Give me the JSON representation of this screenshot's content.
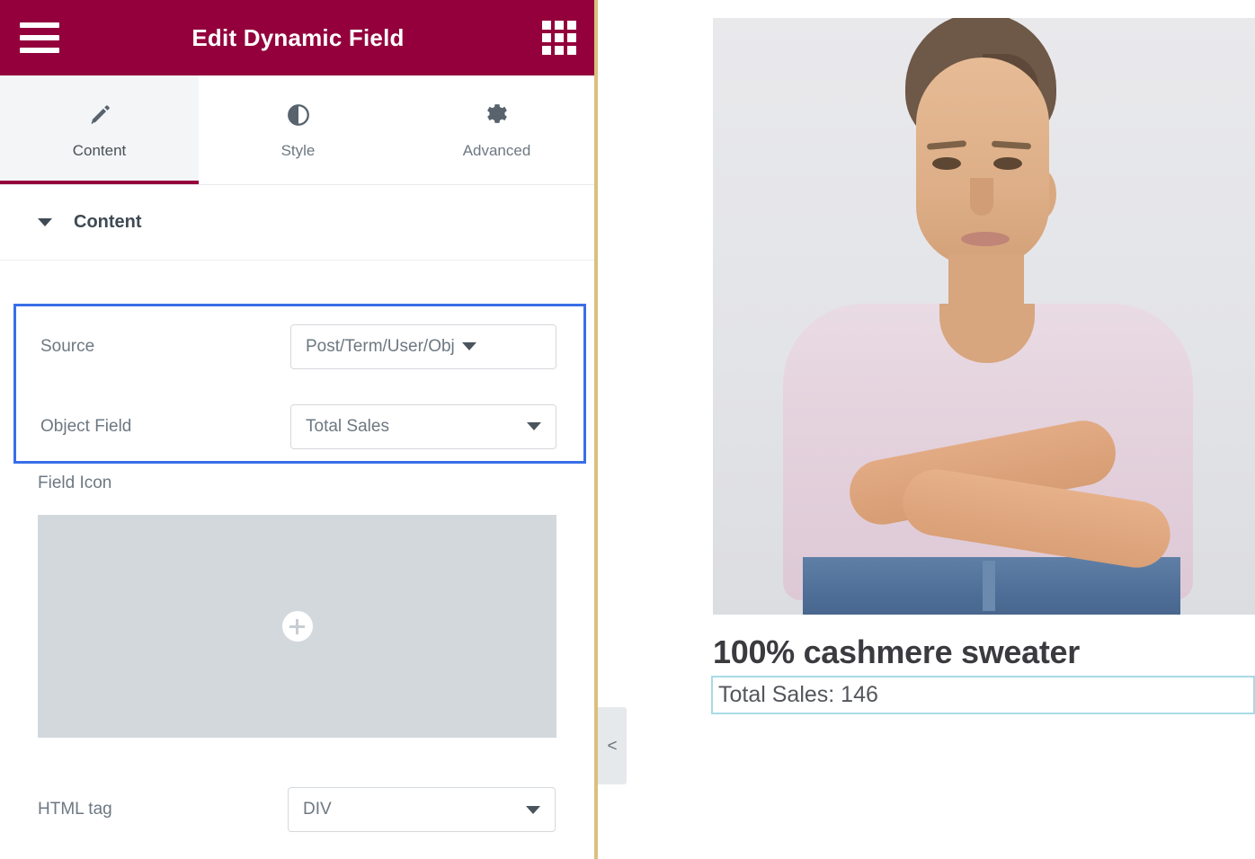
{
  "panel": {
    "header": {
      "title": "Edit Dynamic Field",
      "menu_icon": "hamburger-menu-icon",
      "apps_icon": "widgets-grid-icon",
      "bg_color": "#93003c"
    },
    "tabs": [
      {
        "label": "Content",
        "icon": "pencil-icon",
        "active": true
      },
      {
        "label": "Style",
        "icon": "contrast-icon",
        "active": false
      },
      {
        "label": "Advanced",
        "icon": "gear-icon",
        "active": false
      }
    ],
    "section": {
      "title": "Content",
      "caret_icon": "chevron-down-icon",
      "expanded": true
    },
    "highlight_color": "#3a6ee8",
    "controls": [
      {
        "label": "Source",
        "value": "Post/Term/User/Obj",
        "caret_icon": "chevron-down-icon",
        "highlighted": true
      },
      {
        "label": "Object Field",
        "value": "Total Sales",
        "caret_icon": "chevron-down-icon",
        "highlighted": true
      }
    ],
    "field_icon": {
      "label": "Field Icon",
      "add_icon": "plus-icon",
      "placeholder_color": "#d3d8dd"
    },
    "html_tag": {
      "label": "HTML tag",
      "value": "DIV",
      "caret_icon": "chevron-down-icon"
    },
    "collapse_handle": {
      "icon": "chevron-left-icon",
      "label": "<"
    },
    "divider_color": "#d9c07c"
  },
  "preview": {
    "image_alt": "woman-in-pink-cashmere-sweater-photo",
    "product_title": "100% cashmere sweater",
    "dynamic_field_text": "Total Sales:  146",
    "dynamic_field_border": "#a9dbe6"
  }
}
